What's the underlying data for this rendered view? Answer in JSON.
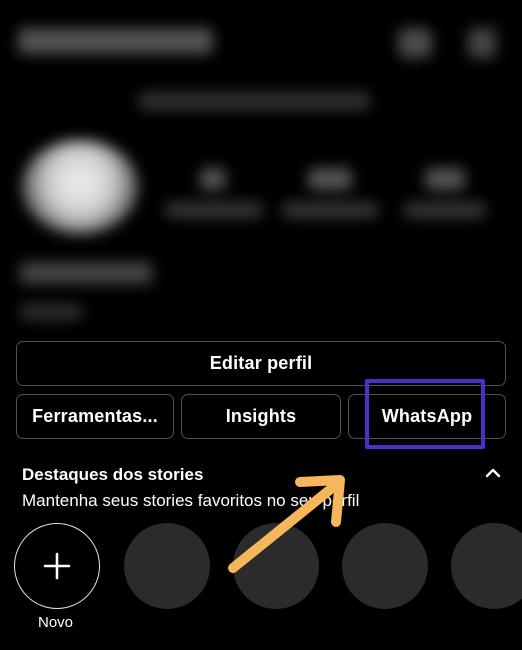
{
  "profile_actions": {
    "edit_profile": "Editar perfil",
    "tools": "Ferramentas...",
    "insights": "Insights",
    "whatsapp": "WhatsApp"
  },
  "highlights": {
    "title": "Destaques dos stories",
    "subtitle": "Mantenha seus stories favoritos no seu perfil",
    "new_label": "Novo",
    "collapse_icon": "chevron-up-icon",
    "new_icon": "plus-icon",
    "placeholder_count": 4
  },
  "annotation": {
    "highlight_color": "#4d2ec9",
    "arrow_color": "#f5b65c"
  }
}
